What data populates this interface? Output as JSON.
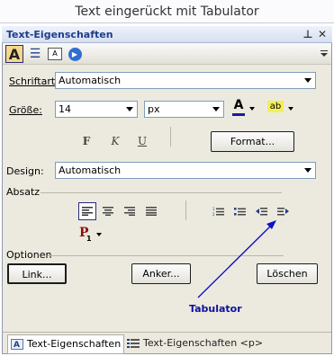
{
  "caption": "Text eingerückt mit Tabulator",
  "panel": {
    "title": "Text-Eigenschaften",
    "pin_glyph": "⊥",
    "close_glyph": "✕"
  },
  "toolbar": {
    "text_props_glyph": "A",
    "list_glyph": "☰",
    "image_glyph": "A",
    "play_glyph": "▶"
  },
  "form": {
    "font_label": "Schriftart:",
    "font_value": "Automatisch",
    "size_label": "Größe:",
    "size_value": "14",
    "unit_value": "px",
    "font_color_glyph": "A",
    "highlight_glyph": "ab",
    "bold_glyph": "F",
    "italic_glyph": "K",
    "underline_glyph": "U",
    "format_button": "Format...",
    "design_label": "Design:",
    "design_value": "Automatisch",
    "absatz_label": "Absatz",
    "para_glyph": "P",
    "options_label": "Optionen",
    "link_button": "Link...",
    "anchor_button": "Anker...",
    "delete_button": "Löschen"
  },
  "annotation": {
    "label": "Tabulator",
    "color": "#10109a"
  },
  "tabs": [
    {
      "label": "Text-Eigenschaften"
    },
    {
      "label": "Text-Eigenschaften <p>"
    }
  ]
}
